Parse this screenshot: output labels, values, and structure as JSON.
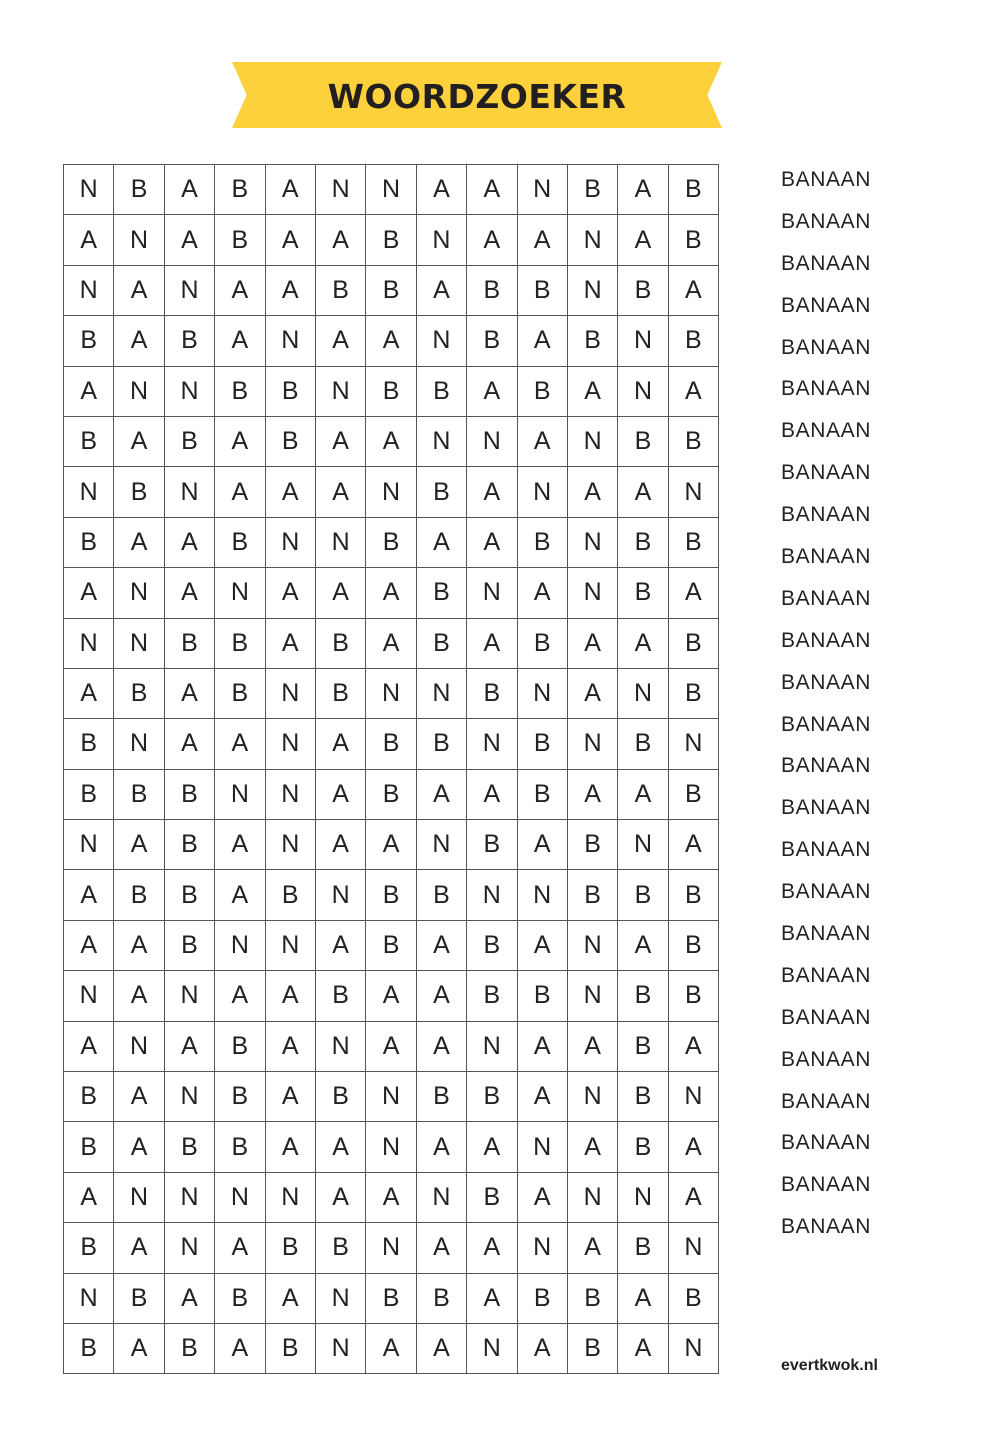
{
  "title": "WOORDZOEKER",
  "grid": [
    "NBABANNAANBAB",
    "ANABAABNAANAB",
    "NANAABBABBNBA",
    "BABANAANBABNB",
    "ANNBBNBBABANA",
    "BABABAANNANBB",
    "NBNAAANBANAAN",
    "BAABNNBAABNBB",
    "ANANAAABNANBA",
    "NNBBABABABAAB",
    "ABABNBNNBNANB",
    "BNAANABBNBNBN",
    "BBBNNABAABAAB",
    "NABANAANBABNA",
    "ABBABNBBNNBBB",
    "AABNNABABANAB",
    "NANAABAABBNBB",
    "ANABANAANAABA",
    "BANBABNBBANBN",
    "BABBAANAANABA",
    "ANNNNAANBANNA",
    "BANABBNAANABN",
    "NBABANBBABBAB",
    "BABABNAANABAN"
  ],
  "words": [
    "BANAAN",
    "BANAAN",
    "BANAAN",
    "BANAAN",
    "BANAAN",
    "BANAAN",
    "BANAAN",
    "BANAAN",
    "BANAAN",
    "BANAAN",
    "BANAAN",
    "BANAAN",
    "BANAAN",
    "BANAAN",
    "BANAAN",
    "BANAAN",
    "BANAAN",
    "BANAAN",
    "BANAAN",
    "BANAAN",
    "BANAAN",
    "BANAAN",
    "BANAAN",
    "BANAAN",
    "BANAAN",
    "BANAAN"
  ],
  "footer": "evertkwok.nl",
  "colors": {
    "banner": "#fcd13b",
    "text": "#222222"
  }
}
